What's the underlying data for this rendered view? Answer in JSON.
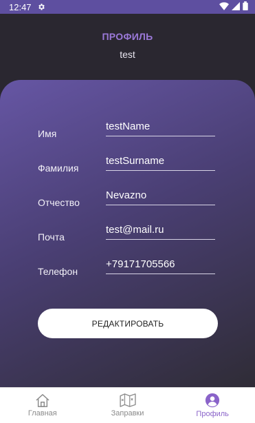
{
  "status_bar": {
    "time": "12:47"
  },
  "header": {
    "title": "ПРОФИЛЬ",
    "subtitle": "test"
  },
  "form": {
    "fields": [
      {
        "label": "Имя",
        "value": "testName"
      },
      {
        "label": "Фамилия",
        "value": "testSurname"
      },
      {
        "label": "Отчество",
        "value": "Nevazno"
      },
      {
        "label": "Почта",
        "value": "test@mail.ru"
      },
      {
        "label": "Телефон",
        "value": "+79171705566"
      }
    ],
    "edit_button": "РЕДАКТИРОВАТЬ"
  },
  "bottom_nav": {
    "items": [
      {
        "label": "Главная",
        "icon": "home-icon",
        "active": false
      },
      {
        "label": "Заправки",
        "icon": "map-icon",
        "active": false
      },
      {
        "label": "Профиль",
        "icon": "profile-icon",
        "active": true
      }
    ]
  },
  "colors": {
    "status_bar": "#5e4fa0",
    "accent": "#9b79d9",
    "nav_active": "#8a63c9",
    "background": "#2a2730"
  }
}
